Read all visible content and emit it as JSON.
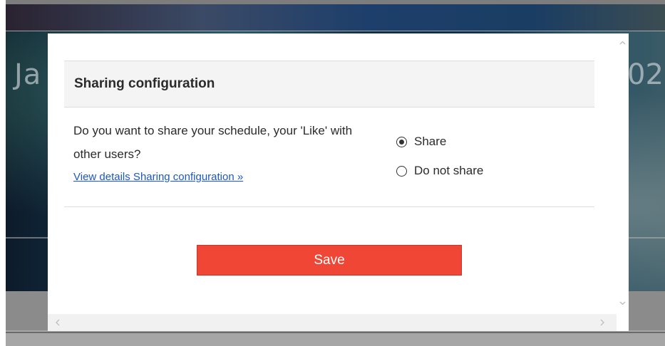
{
  "background": {
    "left_text": "Ja",
    "right_text": "02"
  },
  "modal": {
    "title": "Sharing configuration",
    "question": "Do you want to share your schedule, your 'Like' with other users?",
    "details_link": "View details Sharing configuration »",
    "options": [
      {
        "label": "Share",
        "selected": true
      },
      {
        "label": "Do not share",
        "selected": false
      }
    ],
    "save_label": "Save"
  },
  "icons": {
    "scroll_up": "chevron-up-icon",
    "scroll_down": "chevron-down-icon",
    "scroll_left": "chevron-left-icon",
    "scroll_right": "chevron-right-icon"
  },
  "colors": {
    "save_button": "#f04635",
    "link": "#1a57c8",
    "header_bg": "#f4f4f4"
  }
}
